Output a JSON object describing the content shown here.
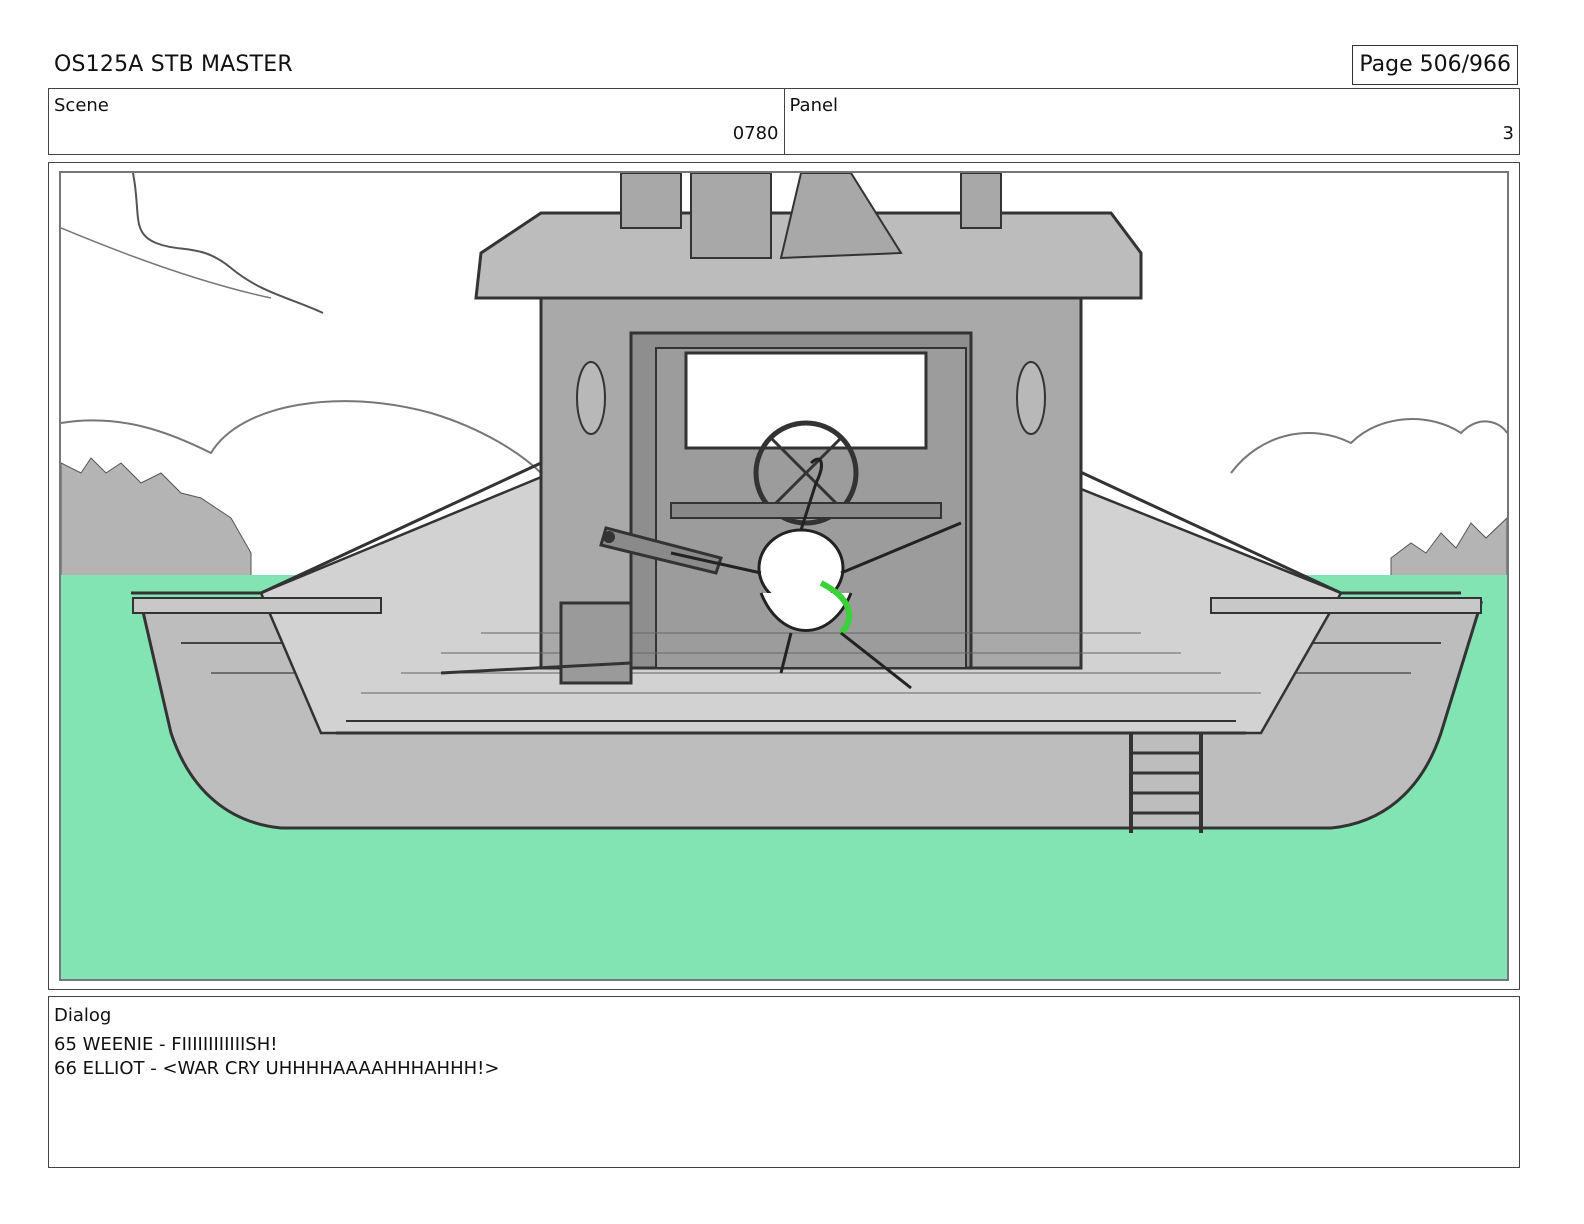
{
  "header": {
    "title": "OS125A STB MASTER",
    "page": "Page 506/966"
  },
  "info": {
    "scene_label": "Scene",
    "scene_value": "0780",
    "panel_label": "Panel",
    "panel_value": "3"
  },
  "colors": {
    "water": "#82e3b3",
    "boat": "#bdbdbd",
    "ink": "#333333",
    "accent_green": "#39d339"
  },
  "dialog": {
    "label": "Dialog",
    "lines": [
      "65 WEENIE - FIIIIIIIIIIIISH!",
      "66 ELLIOT - <WAR CRY UHHHHAAAAHHHAHHH!>"
    ]
  }
}
